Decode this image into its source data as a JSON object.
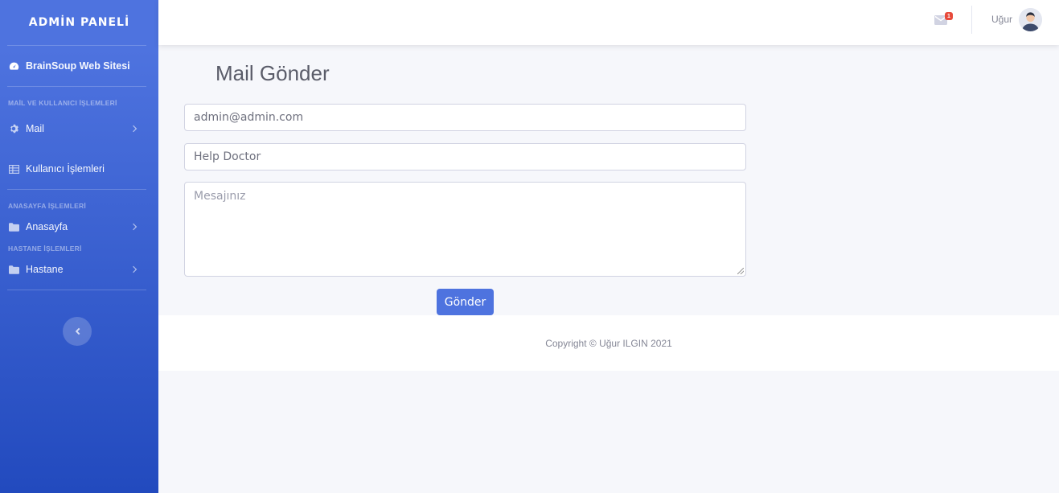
{
  "sidebar": {
    "brand": "ADMİN PANELİ",
    "top_item": {
      "label": "BrainSoup Web Sitesi",
      "icon": "tachometer-icon"
    },
    "sections": [
      {
        "heading": "MAİL VE KULLANICI İŞLEMLERİ"
      },
      {
        "heading": "ANASAYFA İŞLEMLERİ"
      },
      {
        "heading": "HASTANE İŞLEMLERİ"
      }
    ],
    "items": [
      {
        "label": "Mail",
        "icon": "cog-icon"
      },
      {
        "label": "Kullanıcı İşlemleri",
        "icon": "table-icon"
      },
      {
        "label": "Anasayfa",
        "icon": "folder-icon"
      },
      {
        "label": "Hastane",
        "icon": "folder-icon"
      }
    ]
  },
  "topbar": {
    "mail_badge": "1",
    "username": "Uğur"
  },
  "main": {
    "title": "Mail Gönder",
    "email_value": "admin@admin.com",
    "subject_value": "Help Doctor",
    "message_placeholder": "Mesajınız",
    "send_label": "Gönder"
  },
  "footer": {
    "copyright": "Copyright © Uğur ILGIN 2021"
  },
  "colors": {
    "primary": "#4e73df",
    "sidebar_bottom": "#224abe",
    "badge": "#e74a3b",
    "text": "#5a5c69"
  }
}
